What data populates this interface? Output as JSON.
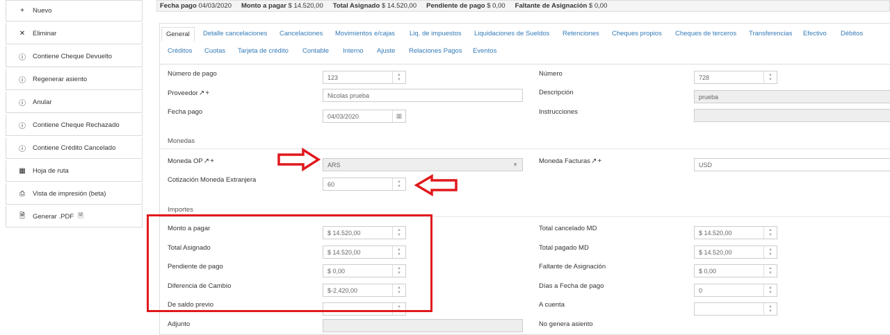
{
  "sidebar": [
    {
      "icon": "plus-icon",
      "glyph": "+",
      "label": "Nuevo"
    },
    {
      "icon": "close-icon",
      "glyph": "✕",
      "label": "Eliminar"
    },
    {
      "icon": "alert-circle-icon",
      "glyph": "ⓘ",
      "label": "Contiene Cheque Devuelto"
    },
    {
      "icon": "alert-circle-icon",
      "glyph": "ⓘ",
      "label": "Regenerar asiento"
    },
    {
      "icon": "alert-circle-icon",
      "glyph": "ⓘ",
      "label": "Anular"
    },
    {
      "icon": "alert-circle-icon",
      "glyph": "ⓘ",
      "label": "Contiene Cheque Rechazado"
    },
    {
      "icon": "alert-circle-icon",
      "glyph": "ⓘ",
      "label": "Contiene Crédito Cancelado"
    },
    {
      "icon": "calendar-icon",
      "glyph": "▦",
      "label": "Hoja de ruta"
    },
    {
      "icon": "print-icon",
      "glyph": "⎙",
      "label": "Vista de impresión (beta)"
    },
    {
      "icon": "pdf-icon",
      "glyph": "🗎",
      "label": "Generar .PDF"
    }
  ],
  "summary": {
    "fecha_label": "Fecha pago",
    "fecha_value": "04/03/2020",
    "monto_label": "Monto a pagar",
    "monto_value": "$ 14.520,00",
    "asignado_label": "Total Asignado",
    "asignado_value": "$ 14.520,00",
    "pendiente_label": "Pendiente de pago",
    "pendiente_value": "$ 0,00",
    "faltante_label": "Faltante de Asignación",
    "faltante_value": "$ 0,00"
  },
  "tabs_row1": [
    "General",
    "Detalle cancelaciones",
    "Cancelaciones",
    "Movimientos e/cajas",
    "Liq. de impuestos",
    "Liquidaciones de Sueldos",
    "Retenciones",
    "Cheques propios",
    "Cheques de terceros",
    "Transferencias",
    "Efectivo",
    "Débitos"
  ],
  "tabs_row2": [
    "Créditos",
    "Cuotas",
    "Tarjeta de crédito",
    "Contable",
    "Interno",
    "Ajuste",
    "Relaciones Pagos",
    "Eventos"
  ],
  "form": {
    "numero_pago": {
      "label": "Número de pago",
      "value": "123"
    },
    "proveedor": {
      "label": "Proveedor",
      "value": "Nicolas prueba"
    },
    "fecha_pago": {
      "label": "Fecha pago",
      "value": "04/03/2020"
    },
    "numero": {
      "label": "Número",
      "value": "728"
    },
    "descripcion": {
      "label": "Descripción",
      "value": "prueba"
    },
    "instrucciones": {
      "label": "Instrucciones",
      "value": ""
    },
    "monedas_section": "Monedas",
    "moneda_op": {
      "label": "Moneda OP",
      "value": "ARS"
    },
    "cotizacion": {
      "label": "Cotización Moneda Extranjera",
      "value": "60"
    },
    "moneda_facturas": {
      "label": "Moneda Facturas",
      "value": "USD"
    },
    "importes_section": "Importes",
    "monto_pagar": {
      "label": "Monto a pagar",
      "value": "$ 14.520,00"
    },
    "total_asignado": {
      "label": "Total Asignado",
      "value": "$ 14.520,00"
    },
    "pendiente_pago": {
      "label": "Pendiente de pago",
      "value": "$ 0,00"
    },
    "diferencia_cambio": {
      "label": "Diferencia de Cambio",
      "value": "$-2.420,00"
    },
    "saldo_previo": {
      "label": "De saldo previo",
      "value": ""
    },
    "adjunto": {
      "label": "Adjunto",
      "value": ""
    },
    "total_cancelado": {
      "label": "Total cancelado MD",
      "value": "$ 14.520,00"
    },
    "total_pagado": {
      "label": "Total pagado MD",
      "value": "$ 14.520,00"
    },
    "faltante_asig": {
      "label": "Faltante de Asignación",
      "value": "$ 0,00"
    },
    "dias_fecha": {
      "label": "Días a Fecha de pago",
      "value": "0"
    },
    "a_cuenta": {
      "label": "A cuenta",
      "value": ""
    },
    "no_genera": {
      "label": "No genera asiento"
    }
  },
  "colors": {
    "link": "#337ab7",
    "annotation_red": "#e0191d"
  }
}
